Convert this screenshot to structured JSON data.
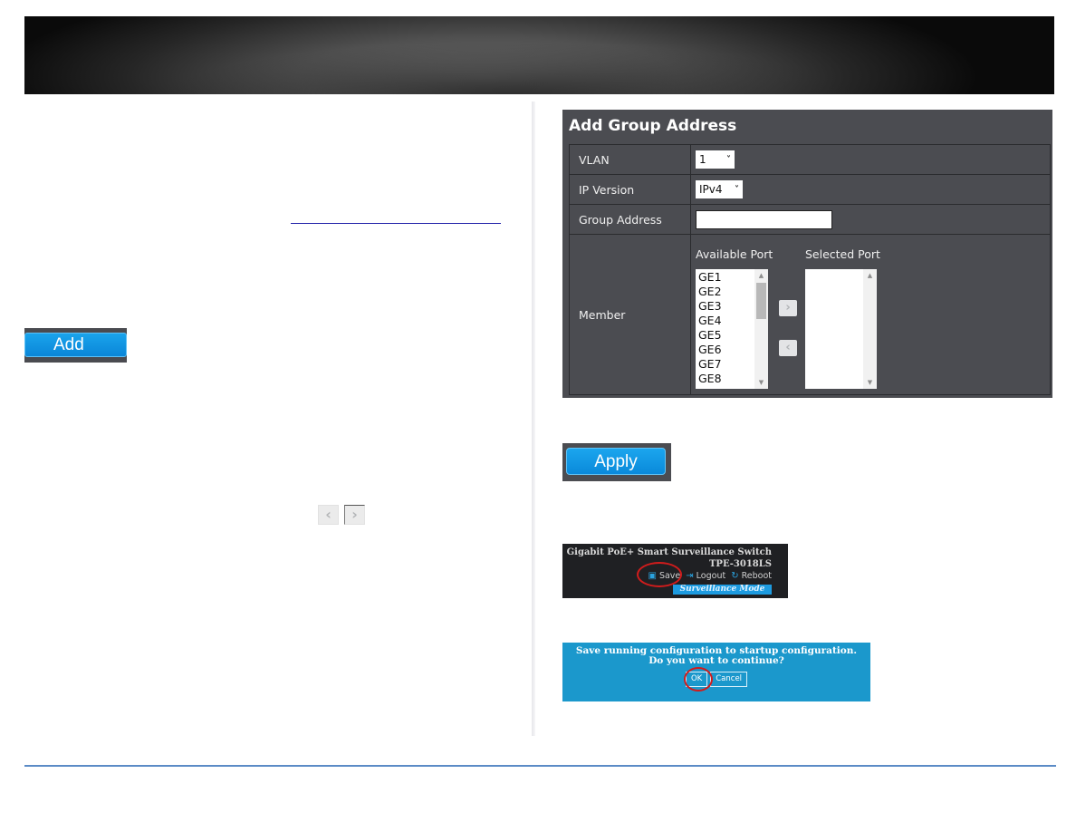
{
  "left_column": {
    "add_button_label": "Add",
    "nav_prev_icon": "chevron-left-icon",
    "nav_next_icon": "chevron-right-icon",
    "nav_prev_glyph": "‹",
    "nav_next_glyph": "›"
  },
  "add_group_panel": {
    "title": "Add Group Address",
    "rows": {
      "vlan": {
        "label": "VLAN",
        "value": "1"
      },
      "ip_version": {
        "label": "IP Version",
        "value": "IPv4"
      },
      "group_address": {
        "label": "Group Address",
        "value": "",
        "placeholder": ""
      },
      "member": {
        "label": "Member",
        "available_title": "Available Port",
        "selected_title": "Selected Port",
        "available_ports": [
          "GE1",
          "GE2",
          "GE3",
          "GE4",
          "GE5",
          "GE6",
          "GE7",
          "GE8"
        ],
        "selected_ports": [],
        "move_right_glyph": "›",
        "move_left_glyph": "‹"
      }
    },
    "chevron_glyph": "⌄"
  },
  "apply_button_label": "Apply",
  "device_header": {
    "title": "Gigabit PoE+ Smart Surveillance Switch",
    "model": "TPE-3018LS",
    "actions": [
      {
        "label": "Save",
        "icon": "save-icon",
        "glyph": "▣"
      },
      {
        "label": "Logout",
        "icon": "logout-icon",
        "glyph": "⇥"
      },
      {
        "label": "Reboot",
        "icon": "reboot-icon",
        "glyph": "↻"
      }
    ],
    "mode_badge": "Surveillance Mode",
    "highlighted_action": "Save"
  },
  "confirm_dialog": {
    "message": "Save running configuration to startup configuration. Do you want to continue?",
    "ok_label": "OK",
    "cancel_label": "Cancel",
    "highlighted_button": "OK"
  },
  "colors": {
    "panel_bg": "#4b4c51",
    "button_blue": "#0a86d8",
    "dialog_blue": "#1b98cc",
    "highlight_red": "#d01c1c",
    "footer_rule": "#5b8bc6"
  }
}
